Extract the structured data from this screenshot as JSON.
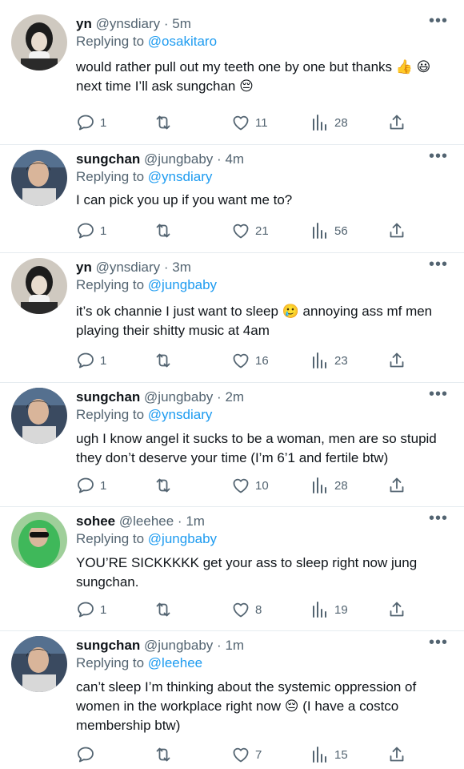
{
  "tweets": [
    {
      "name": "yn",
      "handle": "@ynsdiary",
      "time": "5m",
      "replying_prefix": "Replying to",
      "replying_to": "@osakitaro",
      "text": "would rather pull out my teeth one by one but thanks 👍 😃 next time I’ll ask sungchan 😔",
      "counts": {
        "replies": "1",
        "retweets": "",
        "likes": "11",
        "views": "28"
      },
      "avatar": "yn"
    },
    {
      "name": "sungchan",
      "handle": "@jungbaby",
      "time": "4m",
      "replying_prefix": "Replying to",
      "replying_to": "@ynsdiary",
      "text": "I can pick you up if you want me to?",
      "counts": {
        "replies": "1",
        "retweets": "",
        "likes": "21",
        "views": "56"
      },
      "avatar": "sungchan"
    },
    {
      "name": "yn",
      "handle": "@ynsdiary",
      "time": "3m",
      "replying_prefix": "Replying to",
      "replying_to": "@jungbaby",
      "text": "it’s ok channie I just want to sleep 🥲 annoying ass mf men playing their shitty music at 4am",
      "counts": {
        "replies": "1",
        "retweets": "",
        "likes": "16",
        "views": "23"
      },
      "avatar": "yn"
    },
    {
      "name": "sungchan",
      "handle": "@jungbaby",
      "time": "2m",
      "replying_prefix": "Replying to",
      "replying_to": "@ynsdiary",
      "text": "ugh I know angel it sucks to be a woman, men are so stupid they don’t deserve your time (I’m 6’1 and fertile btw)",
      "counts": {
        "replies": "1",
        "retweets": "",
        "likes": "10",
        "views": "28"
      },
      "avatar": "sungchan"
    },
    {
      "name": "sohee",
      "handle": "@leehee",
      "time": "1m",
      "replying_prefix": "Replying to",
      "replying_to": "@jungbaby",
      "text": "YOU’RE SICKKKKK get your ass to sleep right now jung sungchan.",
      "counts": {
        "replies": "1",
        "retweets": "",
        "likes": "8",
        "views": "19"
      },
      "avatar": "sohee"
    },
    {
      "name": "sungchan",
      "handle": "@jungbaby",
      "time": "1m",
      "replying_prefix": "Replying to",
      "replying_to": "@leehee",
      "text": "can’t sleep I’m thinking about the systemic oppression of women in the workplace right now 😔  (I have a costco membership btw)",
      "counts": {
        "replies": "",
        "retweets": "",
        "likes": "7",
        "views": "15"
      },
      "avatar": "sungchan"
    }
  ],
  "colors": {
    "link": "#1d9bf0",
    "muted": "#536471",
    "text": "#0f1419"
  },
  "icons": [
    "reply-icon",
    "retweet-icon",
    "like-icon",
    "views-icon",
    "share-icon",
    "more-icon"
  ]
}
